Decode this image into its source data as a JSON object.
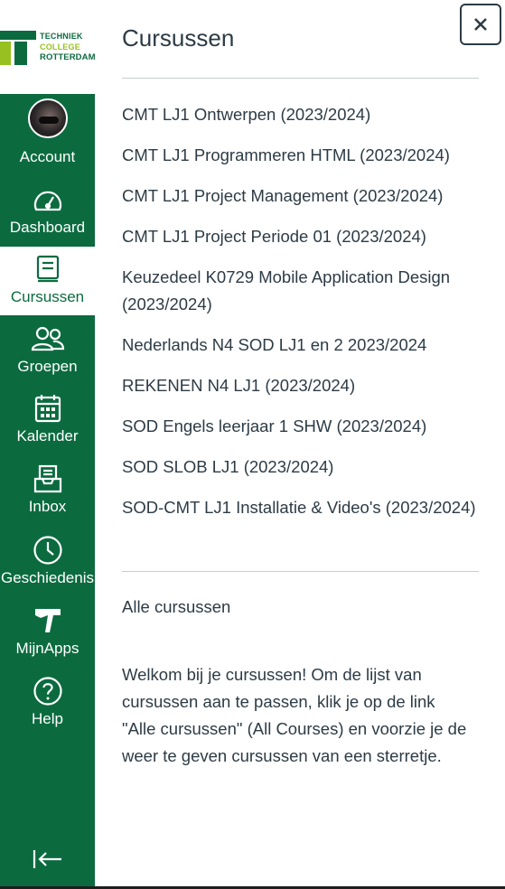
{
  "logo": {
    "line1": "TECHNIEK",
    "line2": "COLLEGE",
    "line3": "ROTTERDAM"
  },
  "nav": {
    "account": "Account",
    "dashboard": "Dashboard",
    "courses": "Cursussen",
    "groups": "Groepen",
    "calendar": "Kalender",
    "inbox": "Inbox",
    "history": "Geschiedenis",
    "apps": "MijnApps",
    "help": "Help"
  },
  "tray": {
    "title": "Cursussen",
    "close_label": "×",
    "courses": [
      "CMT LJ1 Ontwerpen (2023/2024)",
      "CMT LJ1 Programmeren HTML (2023/2024)",
      "CMT LJ1 Project Management (2023/2024)",
      "CMT LJ1 Project Periode 01 (2023/2024)",
      "Keuzedeel K0729 Mobile Application Design (2023/2024)",
      "Nederlands N4 SOD LJ1 en 2 2023/2024",
      "REKENEN N4 LJ1 (2023/2024)",
      "SOD Engels leerjaar 1 SHW (2023/2024)",
      "SOD SLOB LJ1 (2023/2024)",
      "SOD-CMT LJ1 Installatie & Video's (2023/2024)"
    ],
    "all_courses": "Alle cursussen",
    "welcome": "Welkom bij je cursussen! Om de lijst van cursussen aan te passen, klik je op de link \"Alle cursussen\" (All Courses) en voorzie je de weer te geven cursussen van een sterretje."
  },
  "colors": {
    "brand_green": "#0b6b3f",
    "brand_lime": "#96c11f",
    "text": "#2d3b45",
    "divider": "#c7cdd1"
  },
  "icons": {
    "account": "avatar",
    "dashboard": "speedometer-icon",
    "courses": "book-icon",
    "groups": "people-icon",
    "calendar": "calendar-icon",
    "inbox": "inbox-icon",
    "history": "clock-icon",
    "apps": "apps-logo-icon",
    "help": "question-icon",
    "collapse": "arrow-collapse-icon",
    "close": "close-icon"
  }
}
